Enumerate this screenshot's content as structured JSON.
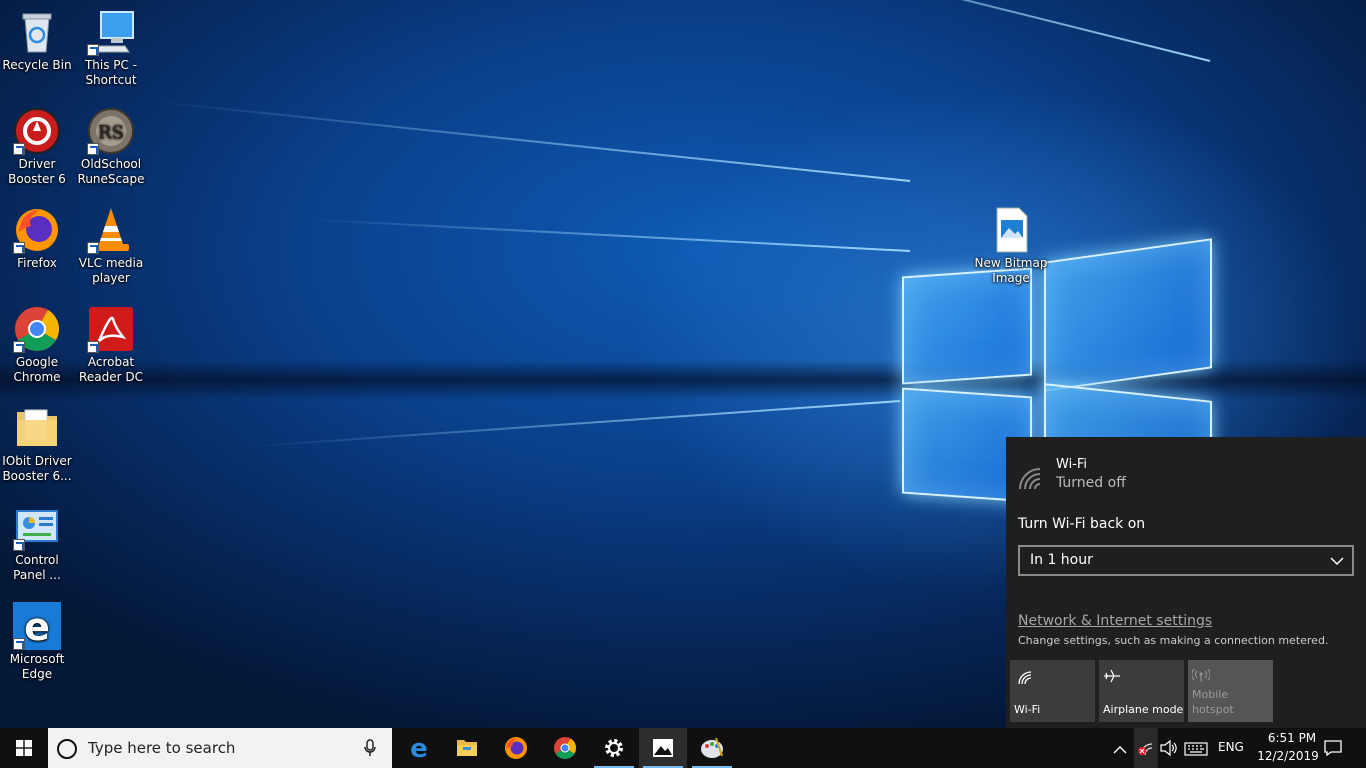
{
  "desktop": {
    "icons": [
      {
        "label": "Recycle Bin"
      },
      {
        "label": "This PC - Shortcut"
      },
      {
        "label": "Driver Booster 6"
      },
      {
        "label": "OldSchool RuneScape"
      },
      {
        "label": "Firefox"
      },
      {
        "label": "VLC media player"
      },
      {
        "label": "Google Chrome"
      },
      {
        "label": "Acrobat Reader DC"
      },
      {
        "label": "IObit Driver Booster 6..."
      },
      {
        "label": "Control Panel ..."
      },
      {
        "label": "Microsoft Edge"
      },
      {
        "label": "New Bitmap Image"
      }
    ]
  },
  "wifi_flyout": {
    "title": "Wi-Fi",
    "status": "Turned off",
    "turn_back_on_label": "Turn Wi-Fi back on",
    "turn_back_on_value": "In 1 hour",
    "settings_link": "Network & Internet settings",
    "settings_desc": "Change settings, such as making a connection metered.",
    "quick_actions": [
      {
        "label": "Wi-Fi",
        "icon": "wifi-icon"
      },
      {
        "label": "Airplane mode",
        "icon": "airplane-icon"
      },
      {
        "label": "Mobile hotspot",
        "icon": "hotspot-icon",
        "disabled": true
      }
    ]
  },
  "taskbar": {
    "search_placeholder": "Type here to search",
    "apps": [
      "Microsoft Edge",
      "File Explorer",
      "Firefox",
      "Google Chrome",
      "Settings",
      "Photos",
      "Paint"
    ],
    "language": "ENG",
    "time": "6:51 PM",
    "date": "12/2/2019"
  },
  "colors": {
    "accent": "#76b9ed",
    "taskbar": "#101010",
    "flyout": "#1f1f1f"
  }
}
